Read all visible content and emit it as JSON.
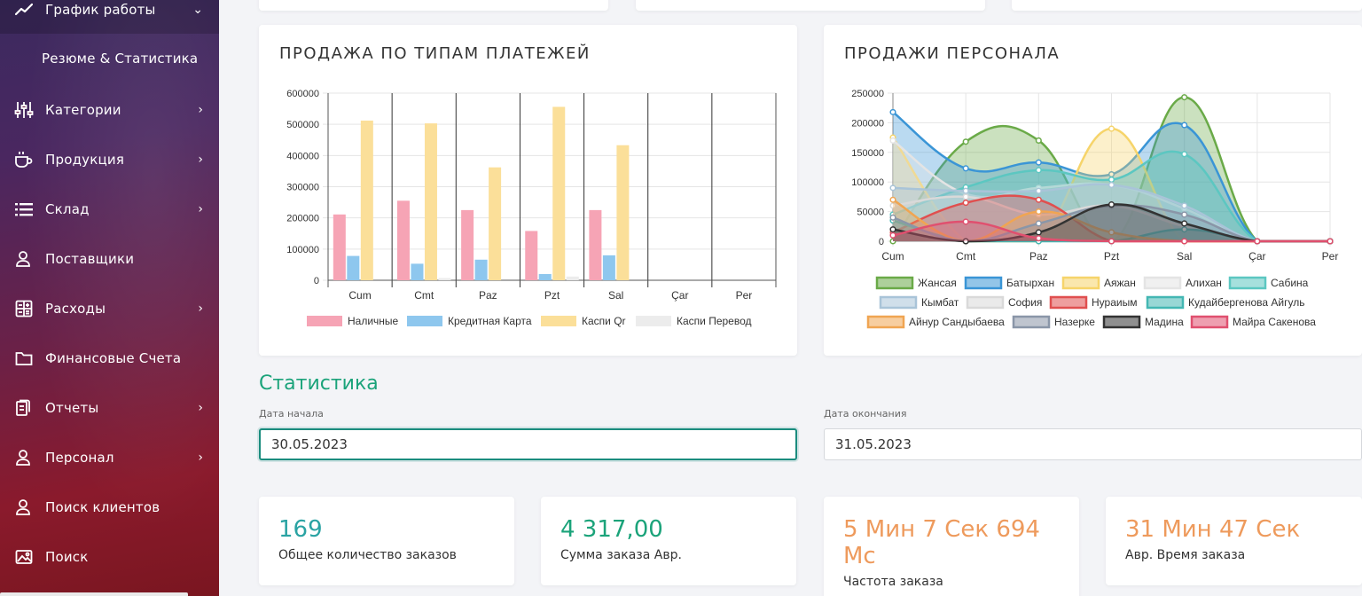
{
  "sidebar": {
    "items": [
      {
        "label": "График работы",
        "icon": "trend-line-icon",
        "chevron": "⌄"
      },
      {
        "label": "Резюме & Статистика"
      },
      {
        "label": "Категории",
        "icon": "sliders-icon",
        "chevron": "›"
      },
      {
        "label": "Продукция",
        "icon": "coffee-cup-icon",
        "chevron": "›"
      },
      {
        "label": "Склад",
        "icon": "list-icon",
        "chevron": "›"
      },
      {
        "label": "Поставщики",
        "icon": "users-icon",
        "chevron": ""
      },
      {
        "label": "Расходы",
        "icon": "calculator-icon",
        "chevron": "›"
      },
      {
        "label": "Финансовые Счета",
        "icon": "folder-icon",
        "chevron": ""
      },
      {
        "label": "Отчеты",
        "icon": "clipboard-icon",
        "chevron": "›"
      },
      {
        "label": "Персонал",
        "icon": "user-icon",
        "chevron": "›"
      },
      {
        "label": "Поиск клиентов",
        "icon": "user-search-icon",
        "chevron": ""
      },
      {
        "label": "Поиск",
        "icon": "image-search-icon",
        "chevron": ""
      }
    ]
  },
  "payments_card": {
    "title": "ПРОДАЖА ПО ТИПАМ ПЛАТЕЖЕЙ"
  },
  "staff_card": {
    "title": "ПРОДАЖИ ПЕРСОНАЛА"
  },
  "statistics": {
    "title": "Статистика",
    "start_label": "Дата начала",
    "start_value": "30.05.2023",
    "end_label": "Дата окончания",
    "end_value": "31.05.2023"
  },
  "stats": [
    {
      "value": "169",
      "label": "Общее количество заказов",
      "color": "#2aa3a3"
    },
    {
      "value": "4 317,00",
      "label": "Сумма заказа Авр.",
      "color": "#1ba37a"
    },
    {
      "value_lines": [
        "5 Мин 7 Сек 694",
        "Мс"
      ],
      "label": "Частота заказа",
      "color": "#ee9a5c"
    },
    {
      "value": "31 Мин 47 Сек",
      "label": "Авр. Время заказа",
      "color": "#ee9a5c"
    }
  ],
  "chart_data": [
    {
      "type": "bar",
      "title": "ПРОДАЖА ПО ТИПАМ ПЛАТЕЖЕЙ",
      "categories": [
        "Cum",
        "Cmt",
        "Paz",
        "Pzt",
        "Sal",
        "Çar",
        "Per"
      ],
      "ylim": [
        0,
        600000
      ],
      "yticks": [
        0,
        100000,
        200000,
        300000,
        400000,
        500000,
        600000
      ],
      "grid": true,
      "legend_position": "bottom",
      "series": [
        {
          "name": "Наличные",
          "color": "#f6a4b5",
          "values": [
            211000,
            255000,
            225000,
            158000,
            225000,
            0,
            0
          ]
        },
        {
          "name": "Кредитная Карта",
          "color": "#8ec7ee",
          "values": [
            78000,
            53000,
            66000,
            20000,
            80000,
            0,
            0
          ]
        },
        {
          "name": "Каспи Qr",
          "color": "#fbdf99",
          "values": [
            512000,
            503000,
            362000,
            556000,
            433000,
            0,
            0
          ]
        },
        {
          "name": "Каспи Перевод",
          "color": "#ececec",
          "values": [
            0,
            7000,
            0,
            12000,
            0,
            0,
            0
          ]
        }
      ]
    },
    {
      "type": "area",
      "title": "ПРОДАЖИ ПЕРСОНАЛА",
      "categories": [
        "Cum",
        "Cmt",
        "Paz",
        "Pzt",
        "Sal",
        "Çar",
        "Per"
      ],
      "ylim": [
        0,
        250000
      ],
      "yticks": [
        0,
        50000,
        100000,
        150000,
        200000,
        250000
      ],
      "grid": true,
      "legend_position": "bottom",
      "series": [
        {
          "name": "Жансая",
          "color": "#6aaa48",
          "values": [
            0,
            168000,
            170000,
            0,
            243000,
            0,
            0
          ]
        },
        {
          "name": "Батырхан",
          "color": "#3a95d6",
          "values": [
            218000,
            123000,
            133000,
            113000,
            196000,
            0,
            0
          ]
        },
        {
          "name": "Аяжан",
          "color": "#f6d46a",
          "values": [
            175000,
            0,
            0,
            190000,
            0,
            0,
            0
          ]
        },
        {
          "name": "Алихан",
          "color": "#e4e4e4",
          "values": [
            170000,
            80000,
            90000,
            95000,
            55000,
            0,
            0
          ]
        },
        {
          "name": "Сабина",
          "color": "#5cc7c1",
          "values": [
            45000,
            91000,
            120000,
            104000,
            147000,
            0,
            0
          ]
        },
        {
          "name": "Кымбат",
          "color": "#a9c4d8",
          "values": [
            90000,
            85000,
            85000,
            95000,
            60000,
            0,
            0
          ]
        },
        {
          "name": "София",
          "color": "#d9d9d9",
          "values": [
            60000,
            75000,
            45000,
            60000,
            25000,
            0,
            0
          ]
        },
        {
          "name": "Нураиым",
          "color": "#e04f4f",
          "values": [
            15000,
            65000,
            70000,
            0,
            0,
            0,
            0
          ]
        },
        {
          "name": "Кудайбергенова Айгуль",
          "color": "#43b7b3",
          "values": [
            35000,
            0,
            0,
            0,
            20000,
            0,
            0
          ]
        },
        {
          "name": "Айнур Сандыбаева",
          "color": "#f0a552",
          "values": [
            70000,
            0,
            50000,
            15000,
            0,
            0,
            0
          ]
        },
        {
          "name": "Назерке",
          "color": "#8a96a8",
          "values": [
            40000,
            0,
            30000,
            60000,
            45000,
            0,
            0
          ]
        },
        {
          "name": "Мадина",
          "color": "#333333",
          "values": [
            20000,
            0,
            15000,
            62000,
            30000,
            0,
            0
          ]
        },
        {
          "name": "Майра Сакенова",
          "color": "#e0506f",
          "values": [
            10000,
            33000,
            5000,
            0,
            0,
            0,
            0
          ]
        }
      ]
    }
  ]
}
